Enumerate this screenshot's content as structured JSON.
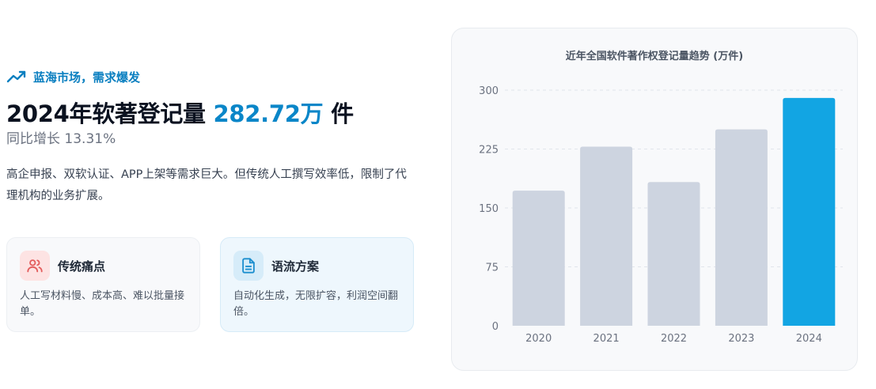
{
  "eyebrow": {
    "text": "蓝海市场，需求爆发",
    "icon": "trending-up-icon"
  },
  "headline": {
    "prefix": "2024年软著登记量",
    "value": "282.72万",
    "suffix": "件"
  },
  "subline": "同比增长 13.31%",
  "description": "高企申报、双软认证、APP上架等需求巨大。但传统人工撰写效率低，限制了代理机构的业务扩展。",
  "cards": {
    "pain": {
      "icon": "users-icon",
      "title": "传统痛点",
      "body": "人工写材料慢、成本高、难以批量接单。"
    },
    "solution": {
      "icon": "document-icon",
      "title": "语流方案",
      "body": "自动化生成，无限扩容，利润空间翻倍。"
    }
  },
  "colors": {
    "accent": "#0a86c8",
    "bar_default": "#cdd4e0",
    "bar_highlight": "#12a5e3",
    "pain_icon": "#e35d5d",
    "solution_icon": "#1d8fcf"
  },
  "chart_data": {
    "type": "bar",
    "title": "近年全国软件著作权登记量趋势 (万件)",
    "categories": [
      "2020",
      "2021",
      "2022",
      "2023",
      "2024"
    ],
    "values": [
      172,
      228,
      183,
      250,
      290
    ],
    "highlight_index": 4,
    "ylim": [
      0,
      300
    ],
    "yticks": [
      0,
      75,
      150,
      225,
      300
    ],
    "grid": "horizontal-dashed",
    "xlabel": "",
    "ylabel": ""
  }
}
